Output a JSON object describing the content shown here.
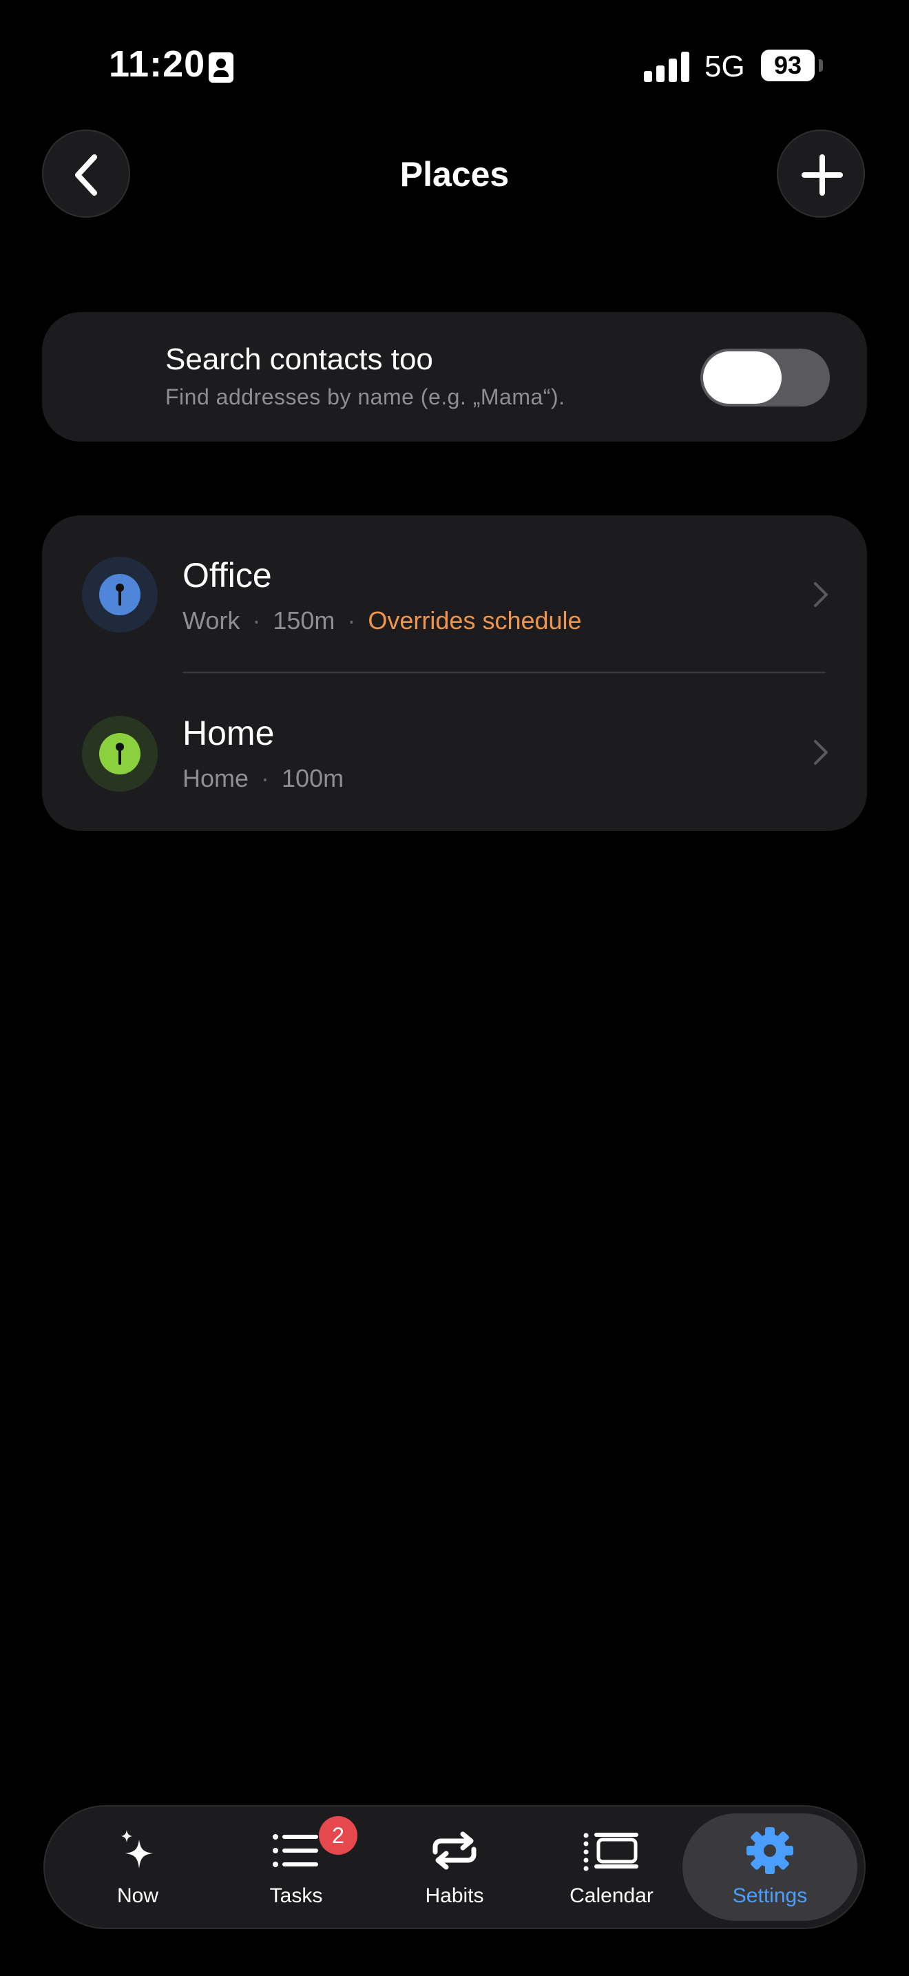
{
  "status_bar": {
    "time": "11:20",
    "network": "5G",
    "battery": "93"
  },
  "header": {
    "title": "Places"
  },
  "contacts_toggle": {
    "title": "Search contacts too",
    "subtitle": "Find addresses by name (e.g. „Mama“).",
    "enabled": false
  },
  "places": [
    {
      "name": "Office",
      "type": "Work",
      "radius": "150m",
      "note": "Overrides schedule",
      "color": "#4f86d9",
      "ring": "#1f2a3d"
    },
    {
      "name": "Home",
      "type": "Home",
      "radius": "100m",
      "note": "",
      "color": "#8bd13d",
      "ring": "#283520"
    }
  ],
  "separator": "·",
  "tabs": [
    {
      "label": "Now",
      "icon": "sparkle-icon"
    },
    {
      "label": "Tasks",
      "icon": "list-icon",
      "badge": "2"
    },
    {
      "label": "Habits",
      "icon": "repeat-icon"
    },
    {
      "label": "Calendar",
      "icon": "calendar-icon"
    },
    {
      "label": "Settings",
      "icon": "gear-icon",
      "active": true
    }
  ],
  "colors": {
    "accent": "#4a9eff",
    "warning": "#f0954a",
    "badge": "#e5484d"
  }
}
